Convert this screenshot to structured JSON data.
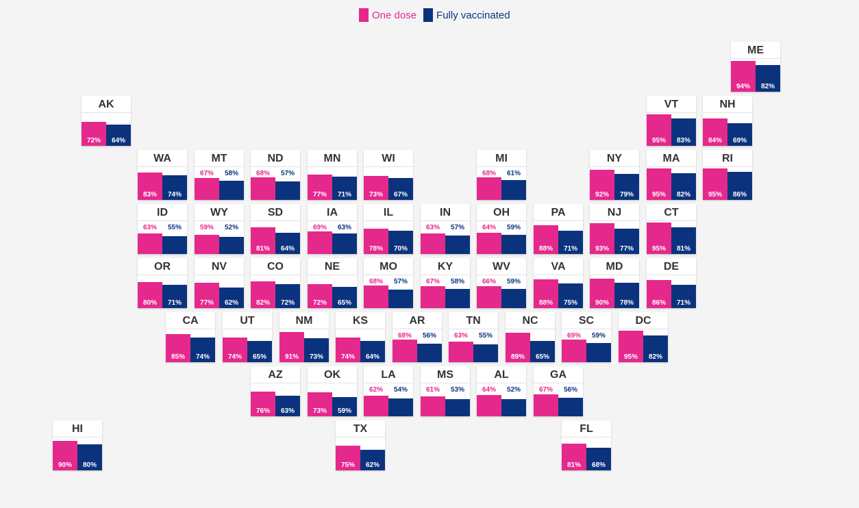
{
  "legend": {
    "one_dose": "One dose",
    "fully_vaccinated": "Fully vaccinated"
  },
  "colors": {
    "one_dose": "#e5288c",
    "fully_vaccinated": "#0b337d"
  },
  "chart_data": {
    "type": "bar",
    "series_names": [
      "One dose",
      "Fully vaccinated"
    ],
    "unit": "%",
    "ylim": [
      0,
      100
    ],
    "states": [
      {
        "abbr": "ME",
        "one": 94,
        "full": 82
      },
      {
        "abbr": "AK",
        "one": 72,
        "full": 64
      },
      {
        "abbr": "VT",
        "one": 95,
        "full": 83
      },
      {
        "abbr": "NH",
        "one": 84,
        "full": 69
      },
      {
        "abbr": "WA",
        "one": 83,
        "full": 74
      },
      {
        "abbr": "MT",
        "one": 67,
        "full": 58
      },
      {
        "abbr": "ND",
        "one": 68,
        "full": 57
      },
      {
        "abbr": "MN",
        "one": 77,
        "full": 71
      },
      {
        "abbr": "WI",
        "one": 73,
        "full": 67
      },
      {
        "abbr": "MI",
        "one": 68,
        "full": 61
      },
      {
        "abbr": "NY",
        "one": 92,
        "full": 79
      },
      {
        "abbr": "MA",
        "one": 95,
        "full": 82
      },
      {
        "abbr": "RI",
        "one": 95,
        "full": 86
      },
      {
        "abbr": "ID",
        "one": 63,
        "full": 55
      },
      {
        "abbr": "WY",
        "one": 59,
        "full": 52
      },
      {
        "abbr": "SD",
        "one": 81,
        "full": 64
      },
      {
        "abbr": "IA",
        "one": 69,
        "full": 63
      },
      {
        "abbr": "IL",
        "one": 78,
        "full": 70
      },
      {
        "abbr": "IN",
        "one": 63,
        "full": 57
      },
      {
        "abbr": "OH",
        "one": 64,
        "full": 59
      },
      {
        "abbr": "PA",
        "one": 88,
        "full": 71
      },
      {
        "abbr": "NJ",
        "one": 93,
        "full": 77
      },
      {
        "abbr": "CT",
        "one": 95,
        "full": 81
      },
      {
        "abbr": "OR",
        "one": 80,
        "full": 71
      },
      {
        "abbr": "NV",
        "one": 77,
        "full": 62
      },
      {
        "abbr": "CO",
        "one": 82,
        "full": 72
      },
      {
        "abbr": "NE",
        "one": 72,
        "full": 65
      },
      {
        "abbr": "MO",
        "one": 68,
        "full": 57
      },
      {
        "abbr": "KY",
        "one": 67,
        "full": 58
      },
      {
        "abbr": "WV",
        "one": 66,
        "full": 59
      },
      {
        "abbr": "VA",
        "one": 88,
        "full": 75
      },
      {
        "abbr": "MD",
        "one": 90,
        "full": 78
      },
      {
        "abbr": "DE",
        "one": 86,
        "full": 71
      },
      {
        "abbr": "CA",
        "one": 85,
        "full": 74
      },
      {
        "abbr": "UT",
        "one": 74,
        "full": 65
      },
      {
        "abbr": "NM",
        "one": 91,
        "full": 73
      },
      {
        "abbr": "KS",
        "one": 74,
        "full": 64
      },
      {
        "abbr": "AR",
        "one": 68,
        "full": 56
      },
      {
        "abbr": "TN",
        "one": 63,
        "full": 55
      },
      {
        "abbr": "NC",
        "one": 89,
        "full": 65
      },
      {
        "abbr": "SC",
        "one": 69,
        "full": 59
      },
      {
        "abbr": "DC",
        "one": 95,
        "full": 82
      },
      {
        "abbr": "AZ",
        "one": 76,
        "full": 63
      },
      {
        "abbr": "OK",
        "one": 73,
        "full": 59
      },
      {
        "abbr": "LA",
        "one": 62,
        "full": 54
      },
      {
        "abbr": "MS",
        "one": 61,
        "full": 53
      },
      {
        "abbr": "AL",
        "one": 64,
        "full": 52
      },
      {
        "abbr": "GA",
        "one": 67,
        "full": 56
      },
      {
        "abbr": "HI",
        "one": 90,
        "full": 80
      },
      {
        "abbr": "TX",
        "one": 75,
        "full": 62
      },
      {
        "abbr": "FL",
        "one": 81,
        "full": 68
      }
    ]
  }
}
